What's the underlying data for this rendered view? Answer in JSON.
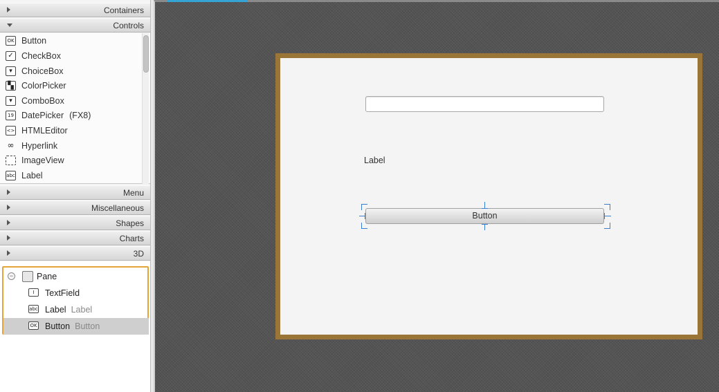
{
  "library": {
    "sections_top": [
      {
        "label": "Containers",
        "expanded": false
      },
      {
        "label": "Controls",
        "expanded": true
      }
    ],
    "controls": [
      {
        "label": "Button",
        "icon": "ok-icon",
        "glyph": "OK"
      },
      {
        "label": "CheckBox",
        "icon": "checkbox-icon",
        "glyph": "✓"
      },
      {
        "label": "ChoiceBox",
        "icon": "choicebox-icon",
        "glyph": "▾"
      },
      {
        "label": "ColorPicker",
        "icon": "colorpicker-icon",
        "glyph": "▚"
      },
      {
        "label": "ComboBox",
        "icon": "combobox-icon",
        "glyph": "▾"
      },
      {
        "label": "DatePicker",
        "sub": "(FX8)",
        "icon": "datepicker-icon",
        "glyph": "19"
      },
      {
        "label": "HTMLEditor",
        "icon": "htmleditor-icon",
        "glyph": "<>"
      },
      {
        "label": "Hyperlink",
        "icon": "hyperlink-icon",
        "glyph": "∞"
      },
      {
        "label": "ImageView",
        "icon": "imageview-icon",
        "glyph": ""
      },
      {
        "label": "Label",
        "icon": "label-icon",
        "glyph": "abc"
      }
    ],
    "sections_bottom": [
      {
        "label": "Menu",
        "expanded": false
      },
      {
        "label": "Miscellaneous",
        "expanded": false
      },
      {
        "label": "Shapes",
        "expanded": false
      },
      {
        "label": "Charts",
        "expanded": false
      },
      {
        "label": "3D",
        "expanded": false
      }
    ]
  },
  "hierarchy": {
    "root": {
      "label": "Pane",
      "toggle": "−"
    },
    "children": [
      {
        "name": "TextField",
        "detail": "",
        "glyph": "I",
        "selected": false
      },
      {
        "name": "Label",
        "detail": "Label",
        "glyph": "abc",
        "selected": false
      },
      {
        "name": "Button",
        "detail": "Button",
        "glyph": "OK",
        "selected": true
      }
    ]
  },
  "canvas": {
    "label_text": "Label",
    "button_text": "Button",
    "text_field_value": ""
  },
  "colors": {
    "pane_border": "#9a7537",
    "selection_orange": "#e3a43a",
    "handle_blue": "#3a7ed0",
    "tab_accent": "#35a4d4"
  }
}
